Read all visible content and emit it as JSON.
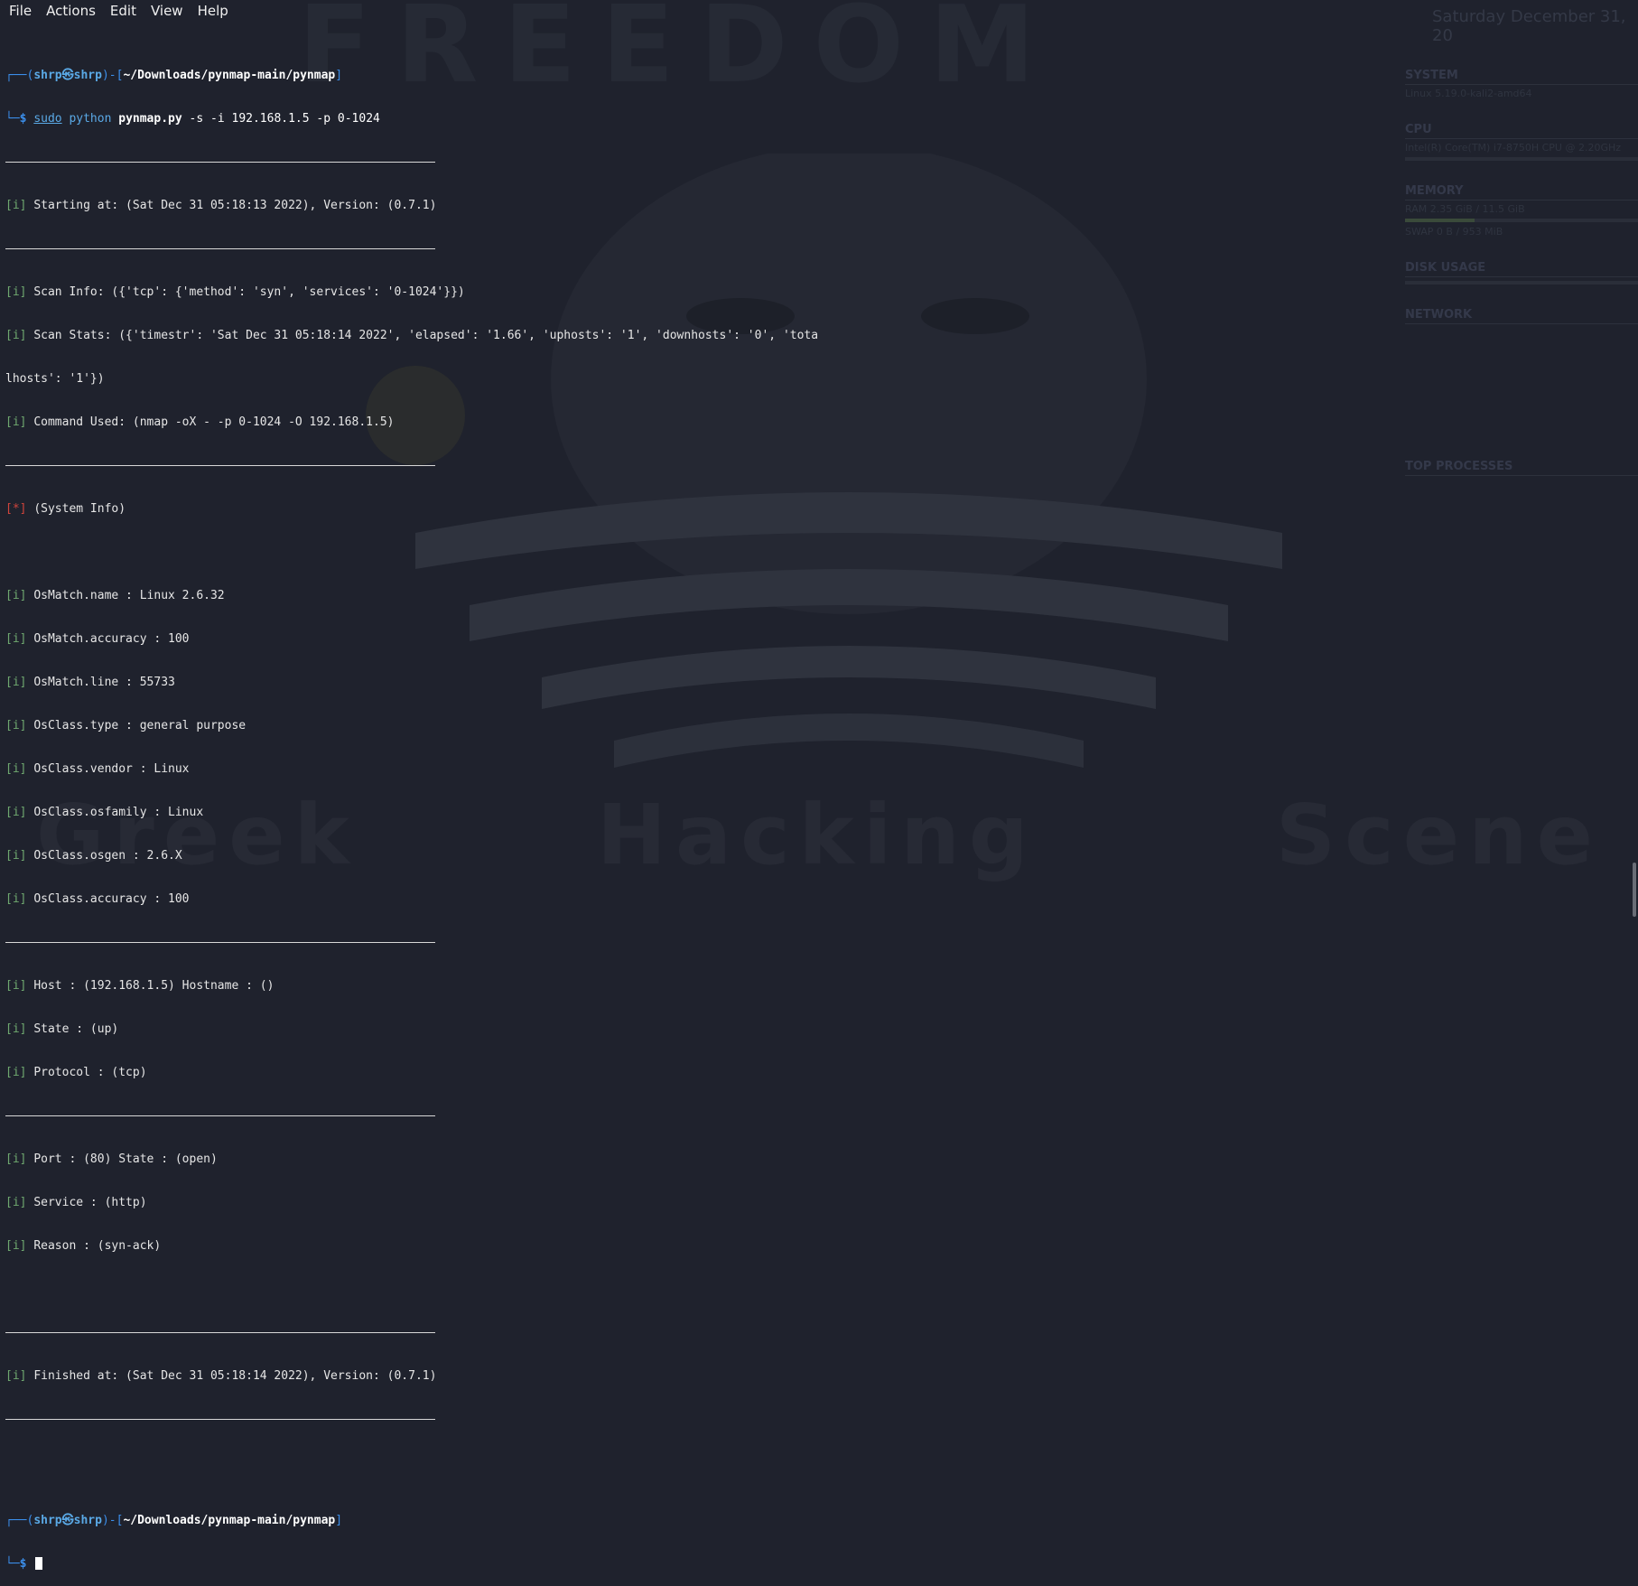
{
  "menu": {
    "file": "File",
    "actions": "Actions",
    "edit": "Edit",
    "view": "View",
    "help": "Help"
  },
  "prompt": {
    "user": "shrp",
    "at": "㉿",
    "host": "shrp",
    "path": "~/Downloads/pynmap-main/pynmap",
    "dollar": "$"
  },
  "command": {
    "sudo": "sudo",
    "python": "python",
    "script": "pynmap.py",
    "args": "-s -i 192.168.1.5 -p 0-1024"
  },
  "output": {
    "starting": "Starting at: (Sat Dec 31 05:18:13 2022), Version: (0.7.1)",
    "scan_info": "Scan Info: ({'tcp': {'method': 'syn', 'services': '0-1024'}})",
    "scan_stats_1": "Scan Stats: ({'timestr': 'Sat Dec 31 05:18:14 2022', 'elapsed': '1.66', 'uphosts': '1', 'downhosts': '0', 'tota",
    "scan_stats_2": "lhosts': '1'})",
    "command_used": "Command Used: (nmap -oX - -p 0-1024 -O 192.168.1.5)",
    "system_info": "(System Info)",
    "os_lines": [
      "OsMatch.name : Linux 2.6.32",
      "OsMatch.accuracy : 100",
      "OsMatch.line : 55733",
      "OsClass.type : general purpose",
      "OsClass.vendor : Linux",
      "OsClass.osfamily : Linux",
      "OsClass.osgen : 2.6.X",
      "OsClass.accuracy : 100"
    ],
    "host_lines": [
      "Host : (192.168.1.5) Hostname : ()",
      "State : (up)",
      "Protocol : (tcp)"
    ],
    "port_lines": [
      "Port : (80) State : (open)",
      "Service : (http)",
      "Reason : (syn-ack)"
    ],
    "finished": "Finished at: (Sat Dec 31 05:18:14 2022), Version: (0.7.1)",
    "tag_i": "[i]",
    "tag_star": "[*]"
  },
  "wallpaper": {
    "title": "FREEDOM",
    "bottom": [
      "Greek",
      "Hacking",
      "Scene"
    ]
  },
  "conky": {
    "date": "Saturday December 31, 20",
    "system": "SYSTEM",
    "system_rows": [
      "Linux 5.19.0-kali2-amd64"
    ],
    "cpu": "CPU",
    "cpu_model": "Intel(R) Core(TM) i7-8750H CPU @ 2.20GHz",
    "memory": "MEMORY",
    "ram": "RAM",
    "ram_value": "2.35 GiB / 11.5 GiB",
    "swap": "SWAP",
    "swap_value": "0 B / 953 MiB",
    "disk": "DISK USAGE",
    "network": "NETWORK",
    "top": "TOP PROCESSES"
  },
  "colors": {
    "background": "#1f222d",
    "prompt_blue": "#3b8eea",
    "info_tag": "#6fa86f",
    "star_tag": "#d0443c"
  }
}
